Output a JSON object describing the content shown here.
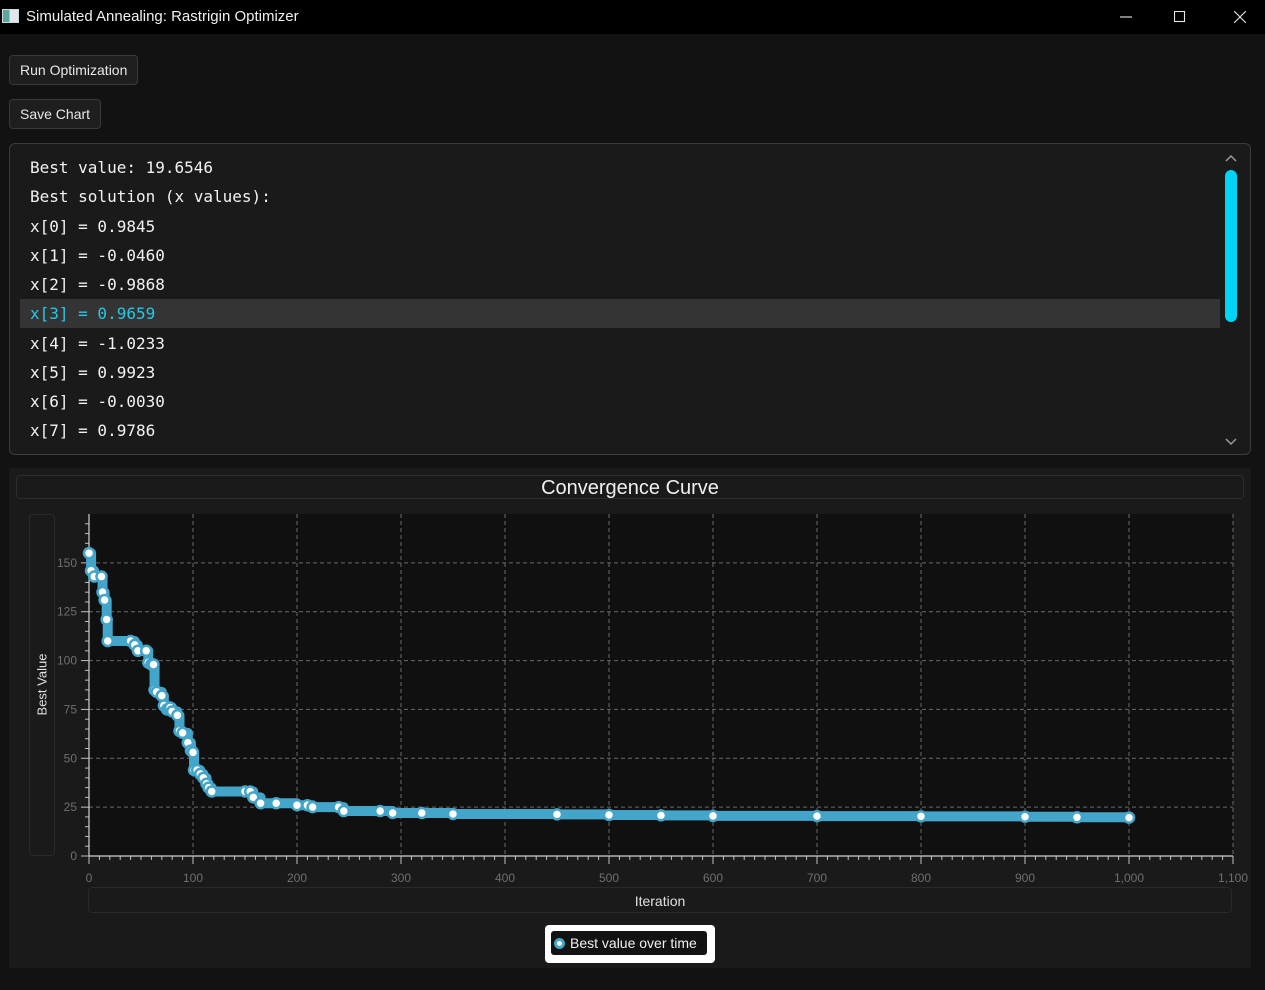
{
  "window": {
    "title": "Simulated Annealing: Rastrigin Optimizer",
    "controls": [
      "minimize",
      "maximize",
      "close"
    ]
  },
  "toolbar": {
    "run_label": "Run Optimization",
    "save_label": "Save Chart"
  },
  "output": {
    "lines": [
      "Best value: 19.6546",
      "Best solution (x values):",
      "x[0] = 0.9845",
      "x[1] = -0.0460",
      "x[2] = -0.9868",
      "x[3] = 0.9659",
      "x[4] = -1.0233",
      "x[5] = 0.9923",
      "x[6] = -0.0030",
      "x[7] = 0.9786"
    ],
    "selected_line": 5
  },
  "colors": {
    "series": "#42a5c9",
    "selection_text": "#23c9e6",
    "scroll_thumb": "#00d4f5"
  },
  "chart_data": {
    "type": "line",
    "title": "Convergence Curve",
    "xlabel": "Iteration",
    "ylabel": "Best Value",
    "xlim": [
      0,
      1100
    ],
    "ylim": [
      0,
      175
    ],
    "x_ticks": [
      "0",
      "100",
      "200",
      "300",
      "400",
      "500",
      "600",
      "700",
      "800",
      "900",
      "1,000",
      "1,100"
    ],
    "y_ticks": [
      "0",
      "25",
      "50",
      "75",
      "100",
      "125",
      "150"
    ],
    "grid": true,
    "legend_position": "bottom-center",
    "series": [
      {
        "name": "Best value over time",
        "points": [
          [
            0,
            155
          ],
          [
            2,
            146
          ],
          [
            5,
            143
          ],
          [
            12,
            143
          ],
          [
            13,
            135
          ],
          [
            15,
            131
          ],
          [
            17,
            121
          ],
          [
            18,
            110
          ],
          [
            40,
            110
          ],
          [
            44,
            108
          ],
          [
            47,
            105
          ],
          [
            55,
            105
          ],
          [
            57,
            99
          ],
          [
            60,
            98
          ],
          [
            62,
            98
          ],
          [
            63,
            85
          ],
          [
            65,
            84
          ],
          [
            70,
            82
          ],
          [
            72,
            77
          ],
          [
            75,
            75
          ],
          [
            77,
            75
          ],
          [
            78,
            76
          ],
          [
            80,
            74
          ],
          [
            85,
            72
          ],
          [
            87,
            64
          ],
          [
            90,
            63
          ],
          [
            95,
            58
          ],
          [
            98,
            54
          ],
          [
            100,
            53
          ],
          [
            101,
            44
          ],
          [
            104,
            44
          ],
          [
            107,
            42
          ],
          [
            110,
            40
          ],
          [
            113,
            37
          ],
          [
            115,
            35
          ],
          [
            118,
            33
          ],
          [
            150,
            33
          ],
          [
            155,
            33
          ],
          [
            158,
            30
          ],
          [
            165,
            27
          ],
          [
            180,
            27
          ],
          [
            200,
            26
          ],
          [
            210,
            26
          ],
          [
            215,
            25
          ],
          [
            240,
            25
          ],
          [
            245,
            23
          ],
          [
            280,
            23
          ],
          [
            292,
            22
          ],
          [
            320,
            22
          ],
          [
            350,
            21.5
          ],
          [
            450,
            21.3
          ],
          [
            500,
            21
          ],
          [
            550,
            20.8
          ],
          [
            600,
            20.5
          ],
          [
            700,
            20.4
          ],
          [
            800,
            20.3
          ],
          [
            900,
            20.1
          ],
          [
            950,
            19.8
          ],
          [
            1000,
            19.65
          ]
        ]
      }
    ]
  }
}
